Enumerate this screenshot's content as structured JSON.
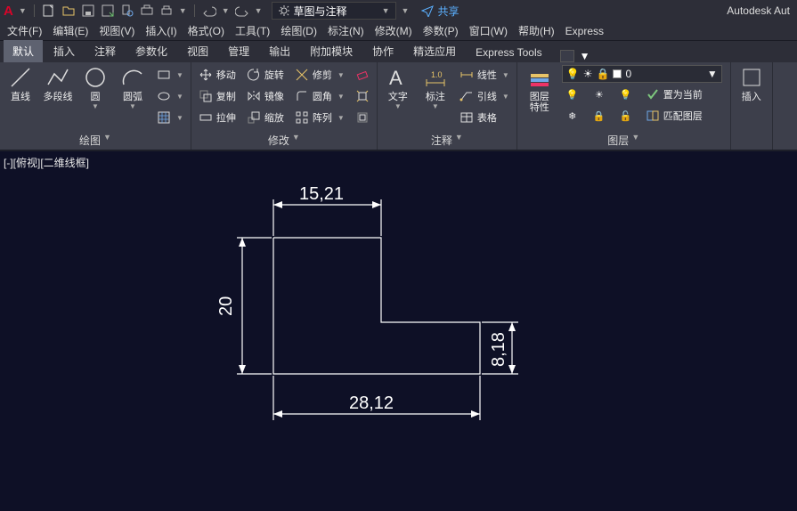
{
  "app_title": "Autodesk Aut",
  "qat": {
    "workspace_label": "草图与注释",
    "share_label": "共享"
  },
  "menubar": [
    "文件(F)",
    "编辑(E)",
    "视图(V)",
    "插入(I)",
    "格式(O)",
    "工具(T)",
    "绘图(D)",
    "标注(N)",
    "修改(M)",
    "参数(P)",
    "窗口(W)",
    "帮助(H)",
    "Express"
  ],
  "ribbon_tabs": [
    "默认",
    "插入",
    "注释",
    "参数化",
    "视图",
    "管理",
    "输出",
    "附加模块",
    "协作",
    "精选应用",
    "Express Tools"
  ],
  "active_tab_index": 0,
  "panels": {
    "draw": {
      "label": "绘图",
      "line": "直线",
      "pline": "多段线",
      "circle": "圆",
      "arc": "圆弧"
    },
    "modify": {
      "label": "修改",
      "move": "移动",
      "rotate": "旋转",
      "trim": "修剪",
      "copy": "复制",
      "mirror": "镜像",
      "fillet": "圆角",
      "stretch": "拉伸",
      "scale": "缩放",
      "array": "阵列"
    },
    "annot": {
      "label": "注释",
      "text": "文字",
      "dim": "标注",
      "linear": "线性",
      "leader": "引线",
      "table": "表格"
    },
    "layers": {
      "label": "图层",
      "props": "图层\n特性",
      "setcurrent": "置为当前",
      "match": "匹配图层",
      "combo_value": "0"
    },
    "insert": {
      "label": "插入"
    }
  },
  "view_label": "[-][俯视][二维线框]",
  "chart_data": {
    "type": "cad-drawing",
    "description": "L-shaped step profile with linear dimensions",
    "dimensions": {
      "top_width": "15,21",
      "total_height": "20",
      "step_height": "8,18",
      "total_width": "28,12"
    }
  }
}
